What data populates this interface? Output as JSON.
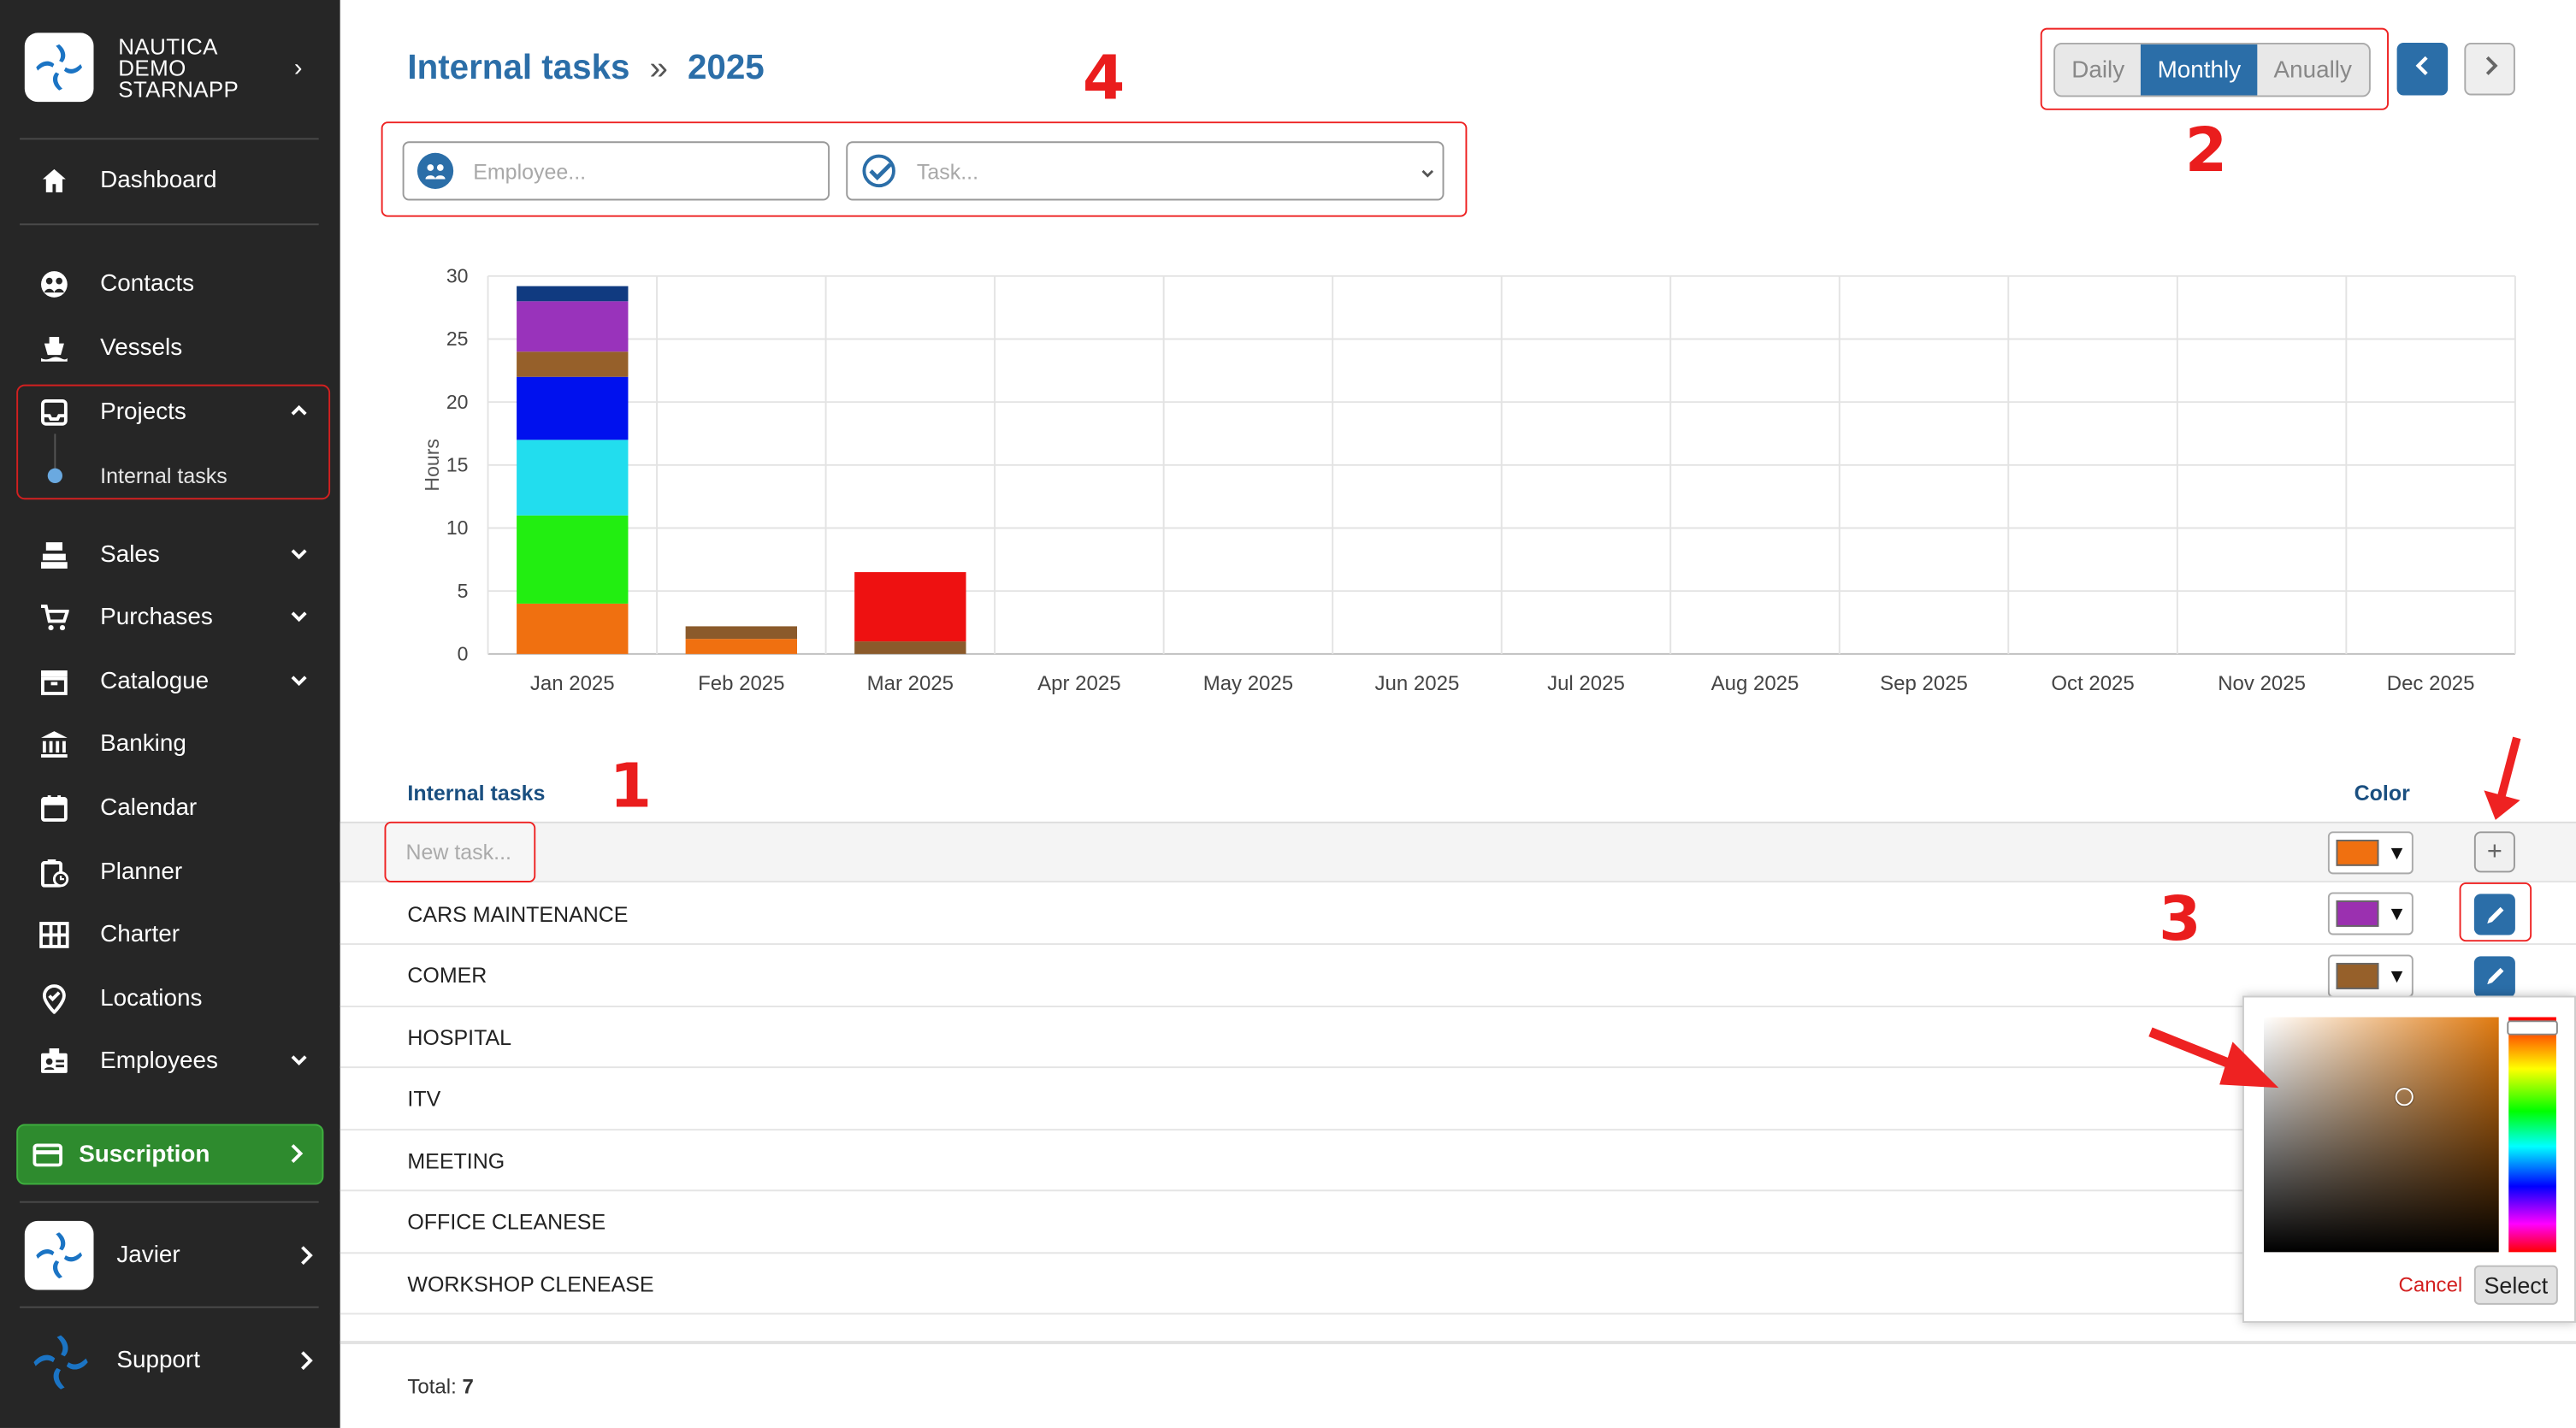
{
  "brand": {
    "name_line1": "NAUTICA",
    "name_line2": "DEMO",
    "name_line3": "STARNAPP"
  },
  "sidebar": {
    "dashboard": "Dashboard",
    "contacts": "Contacts",
    "vessels": "Vessels",
    "projects": "Projects",
    "internal_tasks": "Internal tasks",
    "sales": "Sales",
    "purchases": "Purchases",
    "catalogue": "Catalogue",
    "banking": "Banking",
    "calendar": "Calendar",
    "planner": "Planner",
    "charter": "Charter",
    "locations": "Locations",
    "employees": "Employees",
    "subscription": "Suscription",
    "user": "Javier",
    "support": "Support"
  },
  "header": {
    "section": "Internal tasks",
    "year": "2025"
  },
  "filters": {
    "employee_placeholder": "Employee...",
    "task_placeholder": "Task..."
  },
  "period": {
    "daily": "Daily",
    "monthly": "Monthly",
    "annually": "Anually",
    "selected": "Monthly"
  },
  "annotations": {
    "a1": "1",
    "a2": "2",
    "a3": "3",
    "a4": "4"
  },
  "chart_data": {
    "type": "bar",
    "stacked": true,
    "ylabel": "Hours",
    "ylim": [
      0,
      30
    ],
    "yticks": [
      0,
      5,
      10,
      15,
      20,
      25,
      30
    ],
    "categories": [
      "Jan 2025",
      "Feb 2025",
      "Mar 2025",
      "Apr 2025",
      "May 2025",
      "Jun 2025",
      "Jul 2025",
      "Aug 2025",
      "Sep 2025",
      "Oct 2025",
      "Nov 2025",
      "Dec 2025"
    ],
    "series": [
      {
        "color": "#f07010",
        "values": [
          4,
          1.2,
          0,
          0,
          0,
          0,
          0,
          0,
          0,
          0,
          0,
          0
        ]
      },
      {
        "color": "#8b5a2b",
        "values": [
          0,
          1,
          1,
          0,
          0,
          0,
          0,
          0,
          0,
          0,
          0,
          0
        ]
      },
      {
        "color": "#22ee11",
        "values": [
          7,
          0,
          0,
          0,
          0,
          0,
          0,
          0,
          0,
          0,
          0,
          0
        ]
      },
      {
        "color": "#22ddee",
        "values": [
          6,
          0,
          0,
          0,
          0,
          0,
          0,
          0,
          0,
          0,
          0,
          0
        ]
      },
      {
        "color": "#0011ee",
        "values": [
          5,
          0,
          0,
          0,
          0,
          0,
          0,
          0,
          0,
          0,
          0,
          0
        ]
      },
      {
        "color": "#96602a",
        "values": [
          2,
          0,
          0,
          0,
          0,
          0,
          0,
          0,
          0,
          0,
          0,
          0
        ]
      },
      {
        "color": "#9933bb",
        "values": [
          4,
          0,
          0,
          0,
          0,
          0,
          0,
          0,
          0,
          0,
          0,
          0
        ]
      },
      {
        "color": "#103a80",
        "values": [
          1.2,
          0,
          0,
          0,
          0,
          0,
          0,
          0,
          0,
          0,
          0,
          0
        ]
      },
      {
        "color": "#ee1111",
        "values": [
          0,
          0,
          5.5,
          0,
          0,
          0,
          0,
          0,
          0,
          0,
          0,
          0
        ]
      }
    ]
  },
  "table": {
    "header_name": "Internal tasks",
    "header_color": "Color",
    "new_placeholder": "New task...",
    "new_color": "#f07010",
    "rows": [
      {
        "name": "CARS MAINTENANCE",
        "color": "#9b30b0"
      },
      {
        "name": "COMER",
        "color": "#96602a"
      },
      {
        "name": "HOSPITAL"
      },
      {
        "name": "ITV"
      },
      {
        "name": "MEETING"
      },
      {
        "name": "OFFICE CLEANESE"
      },
      {
        "name": "WORKSHOP CLENEASE"
      }
    ],
    "total_label": "Total:",
    "total_value": "7"
  },
  "color_picker": {
    "cancel": "Cancel",
    "select": "Select",
    "base_color": "#e07a10"
  }
}
